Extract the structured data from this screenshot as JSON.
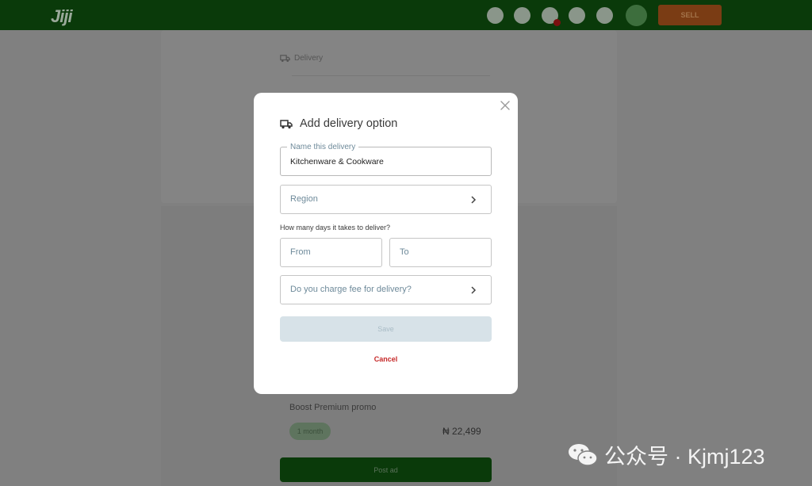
{
  "app": {
    "logo_text": "Jiji"
  },
  "header": {
    "icons": [
      "bookmark-icon",
      "chat-icon",
      "notification-icon",
      "feedback-icon",
      "list-icon"
    ],
    "notification_badge_color": "#7a1010",
    "sell_label": "SELL"
  },
  "background": {
    "delivery_label": "Delivery",
    "boost_label": "Boost Premium promo",
    "duration_label": "1 month",
    "price": "₦ 22,499",
    "post_button_label": "Post ad"
  },
  "modal": {
    "title": "Add delivery option",
    "name_field": {
      "label": "Name this delivery",
      "value": "Kitchenware & Cookware"
    },
    "region_field": {
      "placeholder": "Region"
    },
    "days_question": "How many days it takes to deliver?",
    "from_field": {
      "placeholder": "From"
    },
    "to_field": {
      "placeholder": "To"
    },
    "fee_field": {
      "placeholder": "Do you charge fee for delivery?"
    },
    "save_label": "Save",
    "cancel_label": "Cancel"
  },
  "watermark": {
    "text": "公众号 · Kjmj123"
  },
  "colors": {
    "brand_green": "#0a3a0a",
    "sell_orange": "#7a3c14",
    "cancel_red": "#c62828",
    "save_disabled_bg": "#d7e2e8"
  }
}
